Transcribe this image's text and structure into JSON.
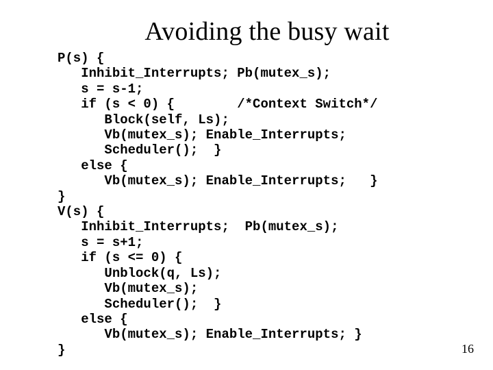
{
  "slide": {
    "title": "Avoiding the busy wait",
    "code": "P(s) {\n   Inhibit_Interrupts; Pb(mutex_s);\n   s = s-1;\n   if (s < 0) {        /*Context Switch*/\n      Block(self, Ls);\n      Vb(mutex_s); Enable_Interrupts;\n      Scheduler();  }\n   else {\n      Vb(mutex_s); Enable_Interrupts;   }\n}\nV(s) {\n   Inhibit_Interrupts;  Pb(mutex_s);\n   s = s+1;\n   if (s <= 0) {\n      Unblock(q, Ls);\n      Vb(mutex_s);\n      Scheduler();  }\n   else {\n      Vb(mutex_s); Enable_Interrupts; }\n}",
    "page_number": "16"
  }
}
